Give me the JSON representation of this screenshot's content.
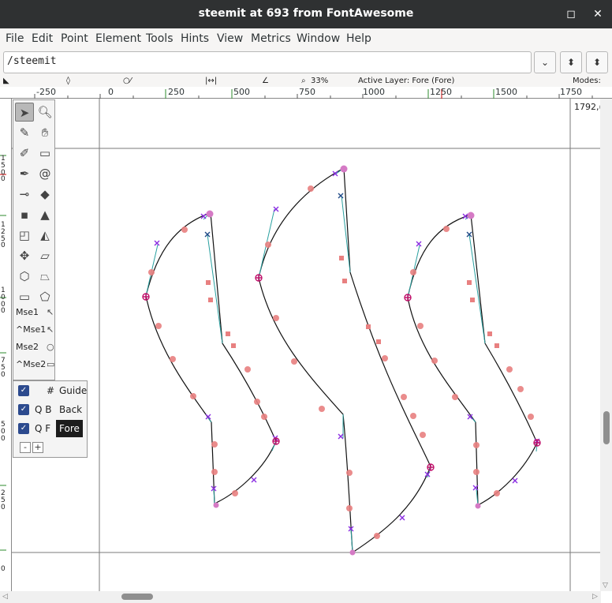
{
  "window": {
    "title": "steemit at 693 from FontAwesome",
    "minimize_glyph": "◻",
    "close_glyph": "✕"
  },
  "menu": {
    "items": [
      "File",
      "Edit",
      "Point",
      "Element",
      "Tools",
      "Hints",
      "View",
      "Metrics",
      "Window",
      "Help"
    ]
  },
  "address": {
    "value": "/steemit",
    "dropdown_glyph": "⌄",
    "prev_glyph": "⬍",
    "next_glyph": "⬍"
  },
  "info": {
    "zoom": "33%",
    "active_layer": "Active Layer: Fore (Fore)",
    "modes": "Modes:"
  },
  "ruler": {
    "h_ticks": [
      "-250",
      "0",
      "250",
      "500",
      "750",
      "1000",
      "1250",
      "1500",
      "1750"
    ],
    "advance_label": "1792,("
  },
  "toolbox": {
    "mouse_labels": [
      "Mse1",
      "^Mse1",
      "Mse2",
      "^Mse2"
    ]
  },
  "layers": {
    "rows": [
      {
        "flags": "#",
        "name": "Guide",
        "checked": true
      },
      {
        "flags": "Q B",
        "name": "Back",
        "checked": true
      },
      {
        "flags": "Q F",
        "name": "Fore",
        "checked": true
      }
    ],
    "remove_label": "-",
    "add_label": "+"
  },
  "colors": {
    "titlebar": "#2f3132",
    "menubar": "#f6f5f4",
    "outline": "#111111",
    "handle": "#7a1fa2",
    "point": "#e88080",
    "extremum": "#c0106a",
    "active_layer_bg": "#1c1c1c"
  },
  "icons": {
    "pointer": "pointer-icon",
    "magnify": "magnify-icon",
    "close": "close-icon",
    "maximize": "maximize-icon"
  }
}
